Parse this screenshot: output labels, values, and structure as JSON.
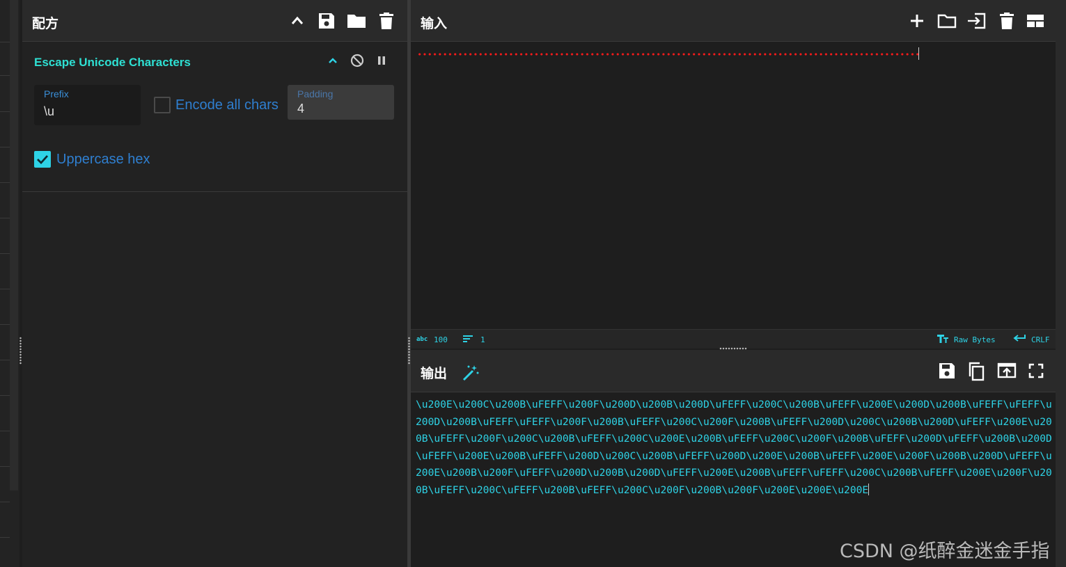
{
  "recipe": {
    "title": "配方",
    "operation": {
      "name": "Escape Unicode Characters",
      "prefix": {
        "label": "Prefix",
        "value": "\\u"
      },
      "encode_all_chars": {
        "label": "Encode all chars",
        "checked": false
      },
      "padding": {
        "label": "Padding",
        "value": "4"
      },
      "uppercase_hex": {
        "label": "Uppercase hex",
        "checked": true
      }
    }
  },
  "input": {
    "title": "输入",
    "status": {
      "length_icon": "abc",
      "length": "100",
      "lines": "1",
      "encoding": "Raw Bytes",
      "eol": "CRLF"
    }
  },
  "output": {
    "title": "输出",
    "text": "\\u200E\\u200C\\u200B\\uFEFF\\u200F\\u200D\\u200B\\u200D\\uFEFF\\u200C\\u200B\\uFEFF\\u200E\\u200D\\u200B\\uFEFF\\uFEFF\\u200D\\u200B\\uFEFF\\uFEFF\\u200F\\u200B\\uFEFF\\u200C\\u200F\\u200B\\uFEFF\\u200D\\u200C\\u200B\\u200D\\uFEFF\\u200E\\u200B\\uFEFF\\u200F\\u200C\\u200B\\uFEFF\\u200C\\u200E\\u200B\\uFEFF\\u200C\\u200F\\u200B\\uFEFF\\u200D\\uFEFF\\u200B\\u200D\\uFEFF\\u200E\\u200B\\uFEFF\\u200D\\u200C\\u200B\\uFEFF\\u200D\\u200E\\u200B\\uFEFF\\u200E\\u200F\\u200B\\u200D\\uFEFF\\u200E\\u200B\\u200F\\uFEFF\\u200D\\u200B\\u200D\\uFEFF\\u200E\\u200B\\uFEFF\\uFEFF\\u200C\\u200B\\uFEFF\\u200E\\u200F\\u200B\\uFEFF\\u200C\\uFEFF\\u200B\\uFEFF\\u200C\\u200F\\u200B\\u200F\\u200E\\u200E\\u200E"
  },
  "watermark": "CSDN @纸醉金迷金手指",
  "colors": {
    "accent": "#2ed3e6",
    "link_blue": "#2f7fd0",
    "error_red": "#ff1a1a",
    "background": "#1e1e1e"
  },
  "icons": {
    "recipe_header": [
      "chevron-up-icon",
      "save-icon",
      "folder-icon",
      "trash-icon"
    ],
    "operation": [
      "chevron-up-icon",
      "disable-icon",
      "pause-icon"
    ],
    "input_header": [
      "plus-icon",
      "folder-icon",
      "import-icon",
      "trash-icon",
      "layout-icon"
    ],
    "output_header": [
      "magic-wand-icon",
      "save-icon",
      "copy-icon",
      "replace-input-icon",
      "fullscreen-icon"
    ]
  }
}
